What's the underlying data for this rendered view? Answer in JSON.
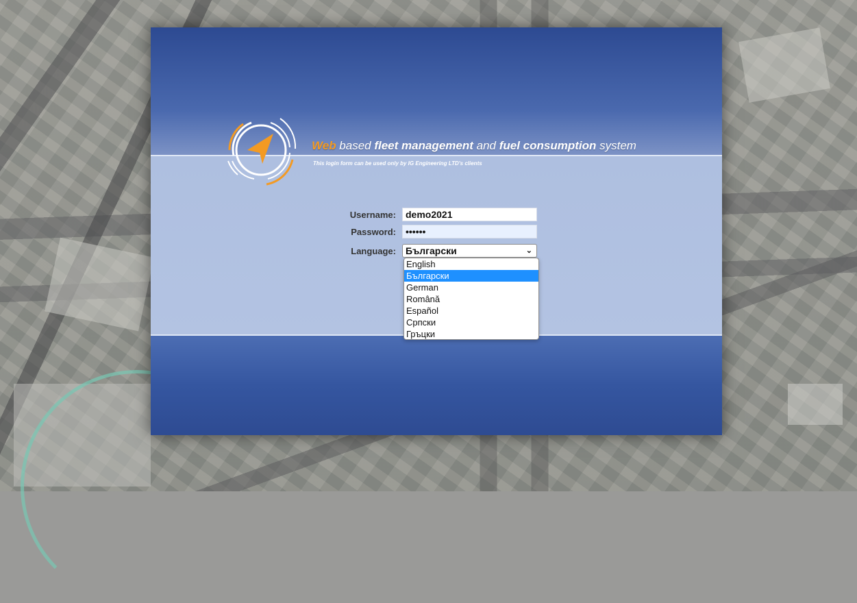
{
  "tagline": {
    "web": "Web",
    "based": " based ",
    "fleet": "fleet management",
    "and": " and ",
    "fuel": "fuel consumption",
    "system": " system"
  },
  "subtitle": "This login form can be used only by IG Engineering LTD's clients",
  "form": {
    "username_label": "Username:",
    "username_value": "demo2021",
    "password_label": "Password:",
    "password_value": "••••••",
    "language_label": "Language:",
    "language_selected": "Български"
  },
  "language_options": [
    "English",
    "Български",
    "German",
    "Română",
    "Español",
    "Српски",
    "Гръцки"
  ],
  "selected_option_index": 1,
  "colors": {
    "accent_orange": "#f39a23",
    "panel_blue": "#3556a0",
    "highlight_blue": "#1e90ff"
  },
  "icons": {
    "logo": "navigation-arrow-icon",
    "dropdown": "chevron-down-icon"
  }
}
